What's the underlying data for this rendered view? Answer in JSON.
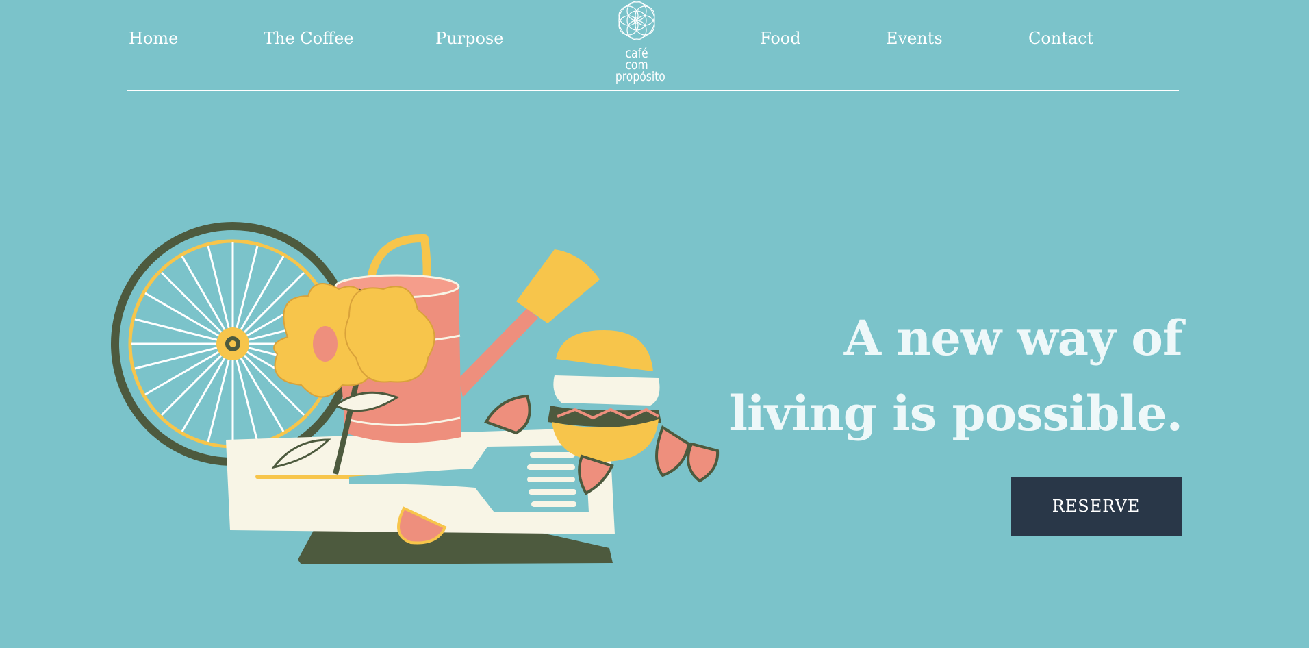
{
  "nav": {
    "items": [
      {
        "label": "Home"
      },
      {
        "label": "The Coffee"
      },
      {
        "label": "Purpose"
      },
      {
        "label": "Food"
      },
      {
        "label": "Events"
      },
      {
        "label": "Contact"
      }
    ]
  },
  "logo": {
    "line1": "café com",
    "line2": "propósito"
  },
  "hero": {
    "headline_line1": "A new way of",
    "headline_line2": "living is possible.",
    "reserve_label": "RESERVE"
  },
  "colors": {
    "background": "#7bc3ca",
    "button": "#293748",
    "text": "#ffffff",
    "accent_yellow": "#f7c54b",
    "accent_coral": "#ee8f7d",
    "accent_dark_green": "#4d5a3e",
    "accent_cream": "#f8f5e6"
  }
}
